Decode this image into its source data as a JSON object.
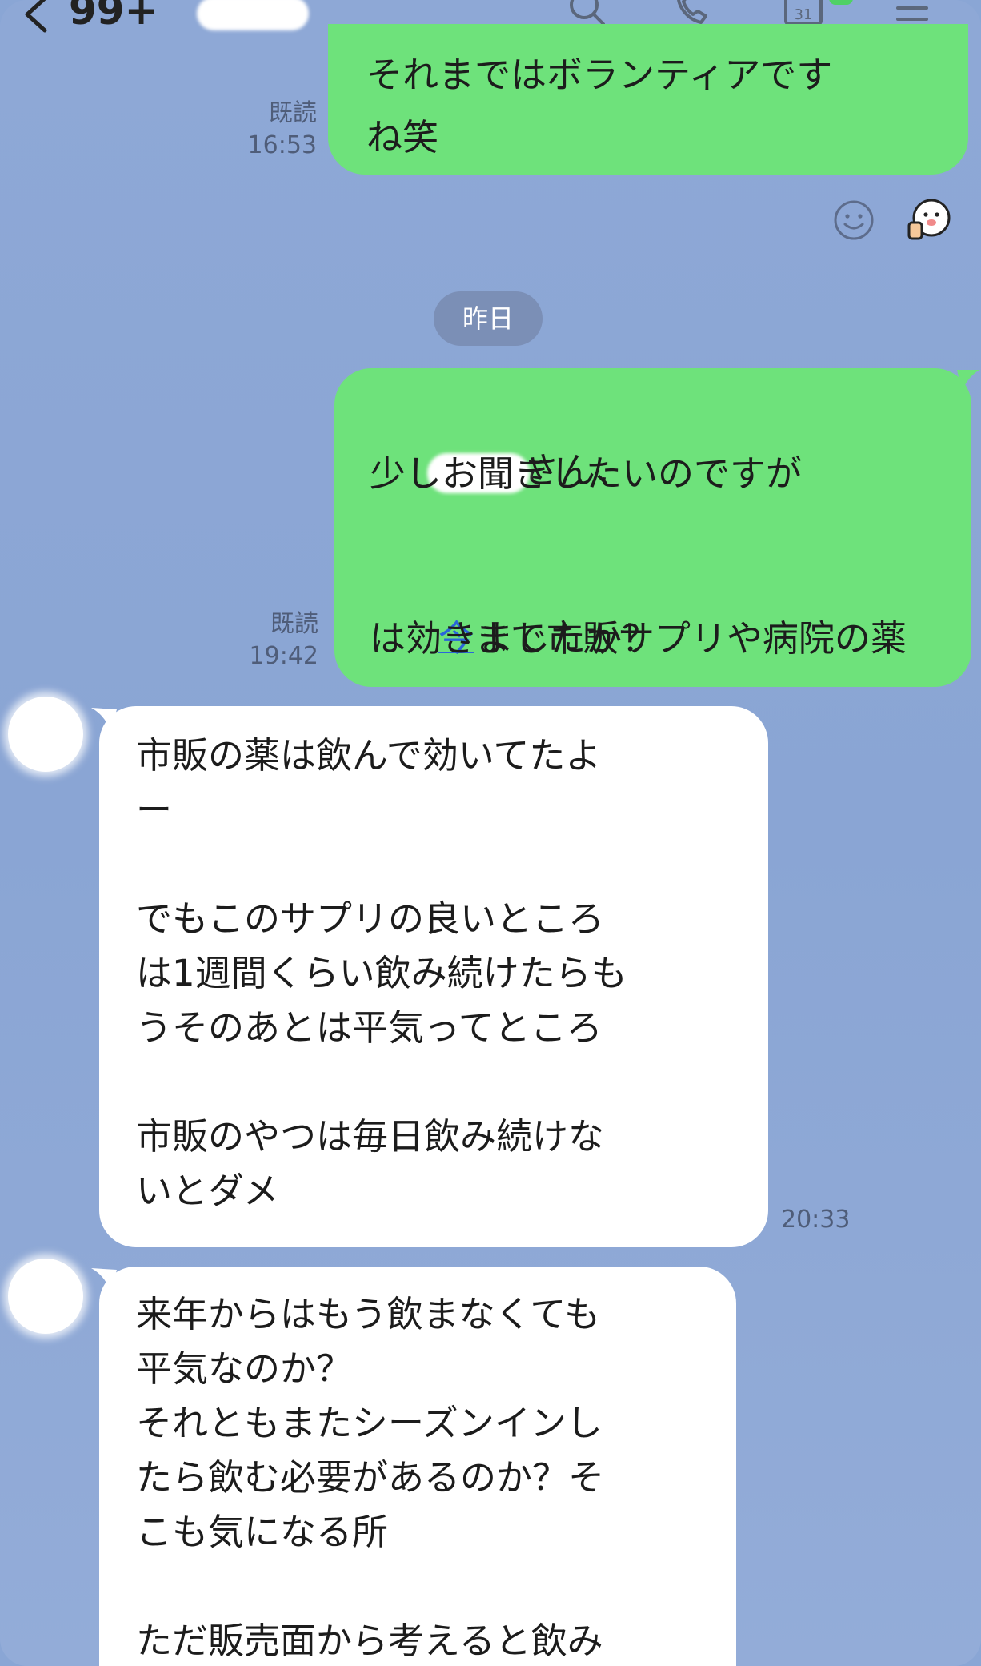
{
  "header": {
    "unread_count": "99+",
    "icons": [
      "back-icon",
      "search-icon",
      "phone-icon",
      "calendar-icon",
      "menu-icon"
    ],
    "calendar_label": "31"
  },
  "messages": {
    "m1": {
      "line1": "それまではボランティアです",
      "line2": "ね笑",
      "read": "既読",
      "time": "16:53"
    },
    "reactions": [
      "smile-icon",
      "thumbs-up-face-icon"
    ],
    "date_divider": "昨日",
    "m2": {
      "line1_suffix": "さん、",
      "line2": "少しお聞きしたいのですが",
      "line4_link": "今",
      "line4_rest": "まで市販サプリや病院の薬",
      "line5": "は効きましたか？",
      "read": "既読",
      "time": "19:42"
    },
    "m3": {
      "text": "市販の薬は飲んで効いてたよ\nー\n\nでもこのサプリの良いところ\nは1週間くらい飲み続けたらも\nうそのあとは平気ってところ\n\n市販のやつは毎日飲み続けな\nいとダメ",
      "time": "20:33"
    },
    "m4": {
      "text": "来年からはもう飲まなくても\n平気なのか？\nそれともまたシーズンインし\nたら飲む必要があるのか？そ\nこも気になる所\n\nただ販売面から考えると飲み"
    }
  },
  "colors": {
    "background": "#8aa6d5",
    "sent_bubble": "#6ee27b",
    "received_bubble": "#ffffff",
    "date_pill": "#7b8fb6",
    "link": "#2a66d9"
  }
}
